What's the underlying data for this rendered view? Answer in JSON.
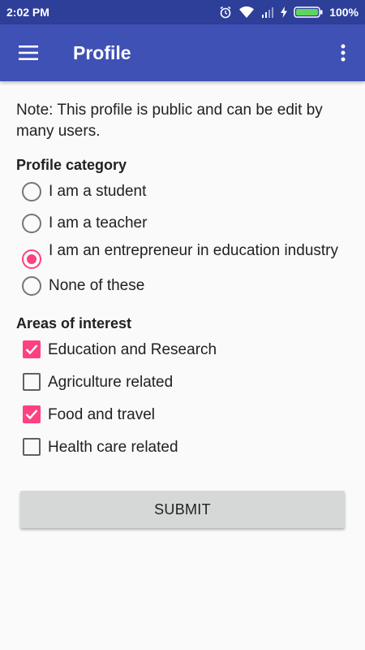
{
  "status_bar": {
    "time": "2:02 PM",
    "battery": "100%",
    "icons": [
      "alarm-icon",
      "wifi-icon",
      "signal-icon",
      "charging-icon",
      "battery-icon"
    ]
  },
  "app_bar": {
    "title": "Profile",
    "menu_icon": "hamburger-menu-icon",
    "overflow_icon": "more-vert-icon",
    "color": "#3f51b5"
  },
  "note": "Note: This profile is public and can be edit by many users.",
  "profile_category": {
    "title": "Profile category",
    "options": [
      {
        "label": "I am a student",
        "selected": false
      },
      {
        "label": "I am a teacher",
        "selected": false
      },
      {
        "label": "I am an entrepreneur in education industry",
        "selected": true
      },
      {
        "label": "None of these",
        "selected": false
      }
    ]
  },
  "areas_of_interest": {
    "title": "Areas of interest",
    "options": [
      {
        "label": "Education and Research",
        "checked": true
      },
      {
        "label": "Agriculture related",
        "checked": false
      },
      {
        "label": "Food and travel",
        "checked": true
      },
      {
        "label": "Health care related",
        "checked": false
      }
    ]
  },
  "submit_label": "SUBMIT",
  "accent_color": "#ff4081"
}
